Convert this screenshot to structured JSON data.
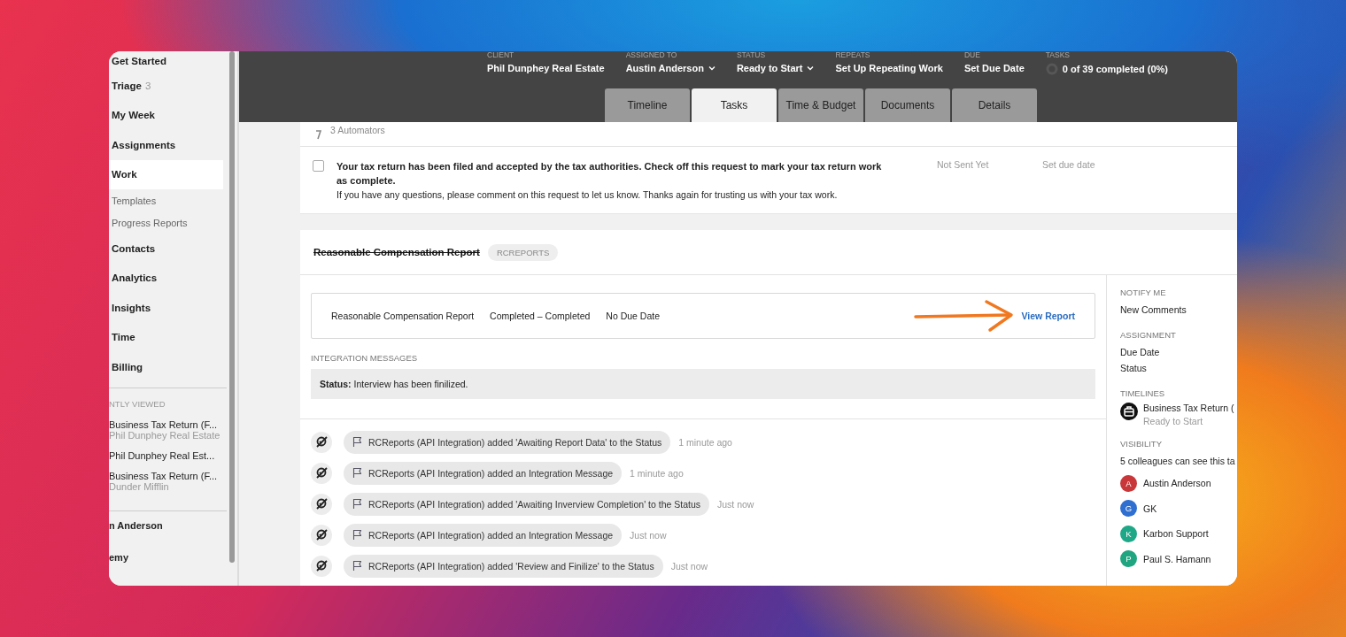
{
  "sidebar": {
    "items": [
      {
        "label": "Get Started",
        "kind": "main",
        "selected": false
      },
      {
        "label": "Triage",
        "count": "3",
        "kind": "main",
        "selected": false
      },
      {
        "label": "My Week",
        "kind": "main",
        "selected": false
      },
      {
        "label": "Assignments",
        "kind": "main",
        "selected": false
      },
      {
        "label": "Work",
        "kind": "main",
        "selected": true
      },
      {
        "label": "Templates",
        "kind": "sub",
        "selected": false
      },
      {
        "label": "Progress Reports",
        "kind": "sub",
        "selected": false
      },
      {
        "label": "Contacts",
        "kind": "main",
        "selected": false
      },
      {
        "label": "Analytics",
        "kind": "main",
        "selected": false
      },
      {
        "label": "Insights",
        "kind": "main",
        "selected": false
      },
      {
        "label": "Time",
        "kind": "main",
        "selected": false
      },
      {
        "label": "Billing",
        "kind": "main",
        "selected": false
      }
    ],
    "recent_heading": "NTLY VIEWED",
    "recent": [
      {
        "title": "Business Tax Return (F...",
        "subtitle": "Phil Dunphey Real Estate"
      },
      {
        "title": "Phil Dunphey Real Est..."
      },
      {
        "title": "Business Tax Return (F...",
        "subtitle": "Dunder Mifflin"
      }
    ],
    "footer": [
      "n Anderson",
      "emy"
    ]
  },
  "header": {
    "meta": [
      {
        "label": "CLIENT",
        "value": "Phil Dunphey Real Estate",
        "kind": "text"
      },
      {
        "label": "ASSIGNED TO",
        "value": "Austin Anderson",
        "kind": "dropdown"
      },
      {
        "label": "STATUS",
        "value": "Ready to Start",
        "kind": "dropdown"
      },
      {
        "label": "REPEATS",
        "value": "Set Up Repeating Work",
        "kind": "text"
      },
      {
        "label": "DUE",
        "value": "Set Due Date",
        "kind": "text"
      },
      {
        "label": "TASKS",
        "value": "0 of 39 completed (0%)",
        "kind": "progress",
        "level": 0
      }
    ],
    "tabs": [
      {
        "label": "Timeline",
        "selected": false
      },
      {
        "label": "Tasks",
        "selected": true
      },
      {
        "label": "Time & Budget",
        "selected": false
      },
      {
        "label": "Documents",
        "selected": false
      },
      {
        "label": "Details",
        "selected": false
      }
    ]
  },
  "automators": "3 Automators",
  "request": {
    "checked": false,
    "title": "Your tax return has been filed and accepted by the tax authorities. Check off this request to mark your tax return work as complete.",
    "body": "If you have any questions, please comment on this request to let us know. Thanks again for trusting us with your tax work.",
    "send_status": "Not Sent Yet",
    "due": "Set due date"
  },
  "report": {
    "title": "Reasonable Compensation Report",
    "completed": true,
    "tag": "RCREPORTS",
    "row": {
      "name": "Reasonable Compensation Report",
      "status": "Completed – Completed",
      "due": "No Due Date",
      "link": "View Report"
    },
    "messages_heading": "INTEGRATION MESSAGES",
    "message": "**Status:** Interview has been finilized.",
    "activity": [
      {
        "text": "RCReports (API Integration) added 'Awaiting Report Data' to the Status",
        "time": "1 minute ago"
      },
      {
        "text": "RCReports (API Integration) added an Integration Message",
        "time": "1 minute ago"
      },
      {
        "text": "RCReports (API Integration) added 'Awaiting Inverview Completion' to the Status",
        "time": "Just now"
      },
      {
        "text": "RCReports (API Integration) added an Integration Message",
        "time": "Just now"
      },
      {
        "text": "RCReports (API Integration) added 'Review and Finilize' to the Status",
        "time": "Just now"
      }
    ]
  },
  "side_panel": {
    "notify": {
      "heading": "NOTIFY ME",
      "items": [
        "New Comments"
      ]
    },
    "assignment": {
      "heading": "ASSIGNMENT",
      "items": [
        "Due Date",
        "Status"
      ]
    },
    "timelines": {
      "heading": "TIMELINES",
      "items": [
        {
          "title": "Business Tax Return (",
          "status": "Ready to Start"
        }
      ]
    },
    "visibility": {
      "heading": "VISIBILITY",
      "summary": "5 colleagues can see this ta",
      "people": [
        {
          "initial": "A",
          "name": "Austin Anderson",
          "color": "#c8373a"
        },
        {
          "initial": "G",
          "name": "GK",
          "color": "#2f6fd0"
        },
        {
          "initial": "K",
          "name": "Karbon Support",
          "color": "#1fa888"
        },
        {
          "initial": "P",
          "name": "Paul S. Hamann",
          "color": "#1fa57f"
        }
      ]
    }
  }
}
